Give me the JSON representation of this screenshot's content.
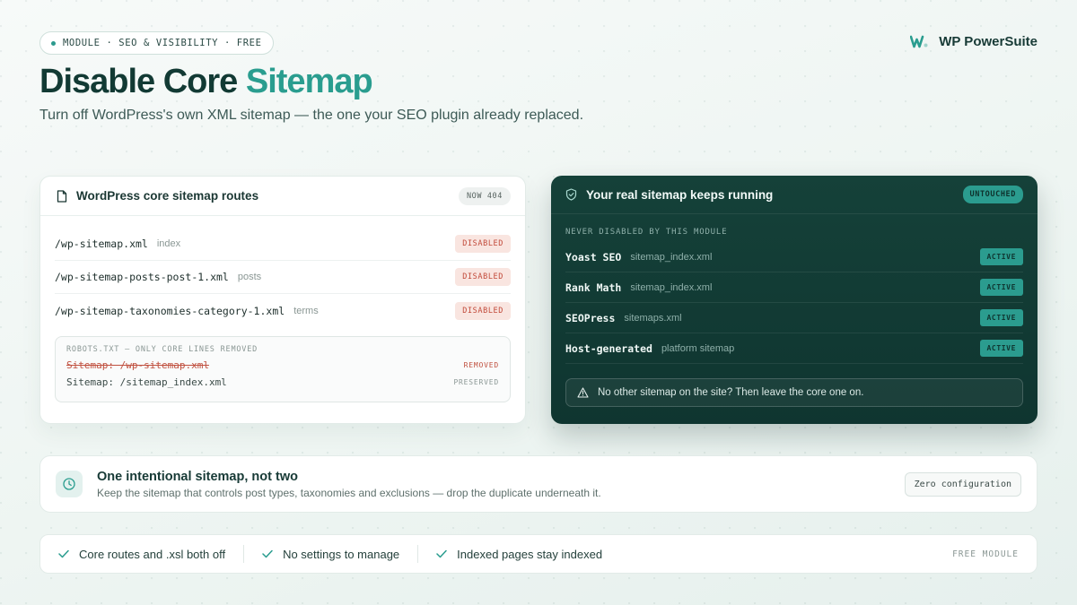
{
  "header": {
    "pill": "MODULE · SEO & VISIBILITY · FREE",
    "brand": "WP PowerSuite",
    "title_main": "Disable Core",
    "title_accent": "Sitemap",
    "subtitle": "Turn off WordPress's own XML sitemap — the one your SEO plugin already replaced."
  },
  "core_card": {
    "title": "WordPress core sitemap routes",
    "badge": "NOW 404",
    "routes": [
      {
        "path": "/wp-sitemap.xml",
        "kind": "index",
        "status": "DISABLED"
      },
      {
        "path": "/wp-sitemap-posts-post-1.xml",
        "kind": "posts",
        "status": "DISABLED"
      },
      {
        "path": "/wp-sitemap-taxonomies-category-1.xml",
        "kind": "terms",
        "status": "DISABLED"
      }
    ],
    "robots": {
      "caption": "ROBOTS.TXT — ONLY CORE LINES REMOVED",
      "removed_line": "Sitemap: /wp-sitemap.xml",
      "removed_status": "REMOVED",
      "kept_line": "Sitemap: /sitemap_index.xml",
      "kept_status": "PRESERVED"
    }
  },
  "real_card": {
    "title": "Your real sitemap keeps running",
    "badge": "UNTOUCHED",
    "caption": "NEVER DISABLED BY THIS MODULE",
    "plugins": [
      {
        "name": "Yoast SEO",
        "file": "sitemap_index.xml",
        "status": "ACTIVE"
      },
      {
        "name": "Rank Math",
        "file": "sitemap_index.xml",
        "status": "ACTIVE"
      },
      {
        "name": "SEOPress",
        "file": "sitemaps.xml",
        "status": "ACTIVE"
      },
      {
        "name": "Host-generated",
        "file": "platform sitemap",
        "status": "ACTIVE"
      }
    ],
    "warning": "No other sitemap on the site? Then leave the core one on."
  },
  "banner": {
    "title": "One intentional sitemap, not two",
    "subtitle": "Keep the sitemap that controls post types, taxonomies and exclusions — drop the duplicate underneath it.",
    "button": "Zero configuration"
  },
  "strip": {
    "features": [
      "Core routes and .xsl both off",
      "No settings to manage",
      "Indexed pages stay indexed"
    ],
    "tag": "FREE MODULE"
  },
  "colors": {
    "accent": "#2a9d8f",
    "dark_card": "#154139",
    "disabled_red": "#c24a3a",
    "heading": "#123a34"
  }
}
